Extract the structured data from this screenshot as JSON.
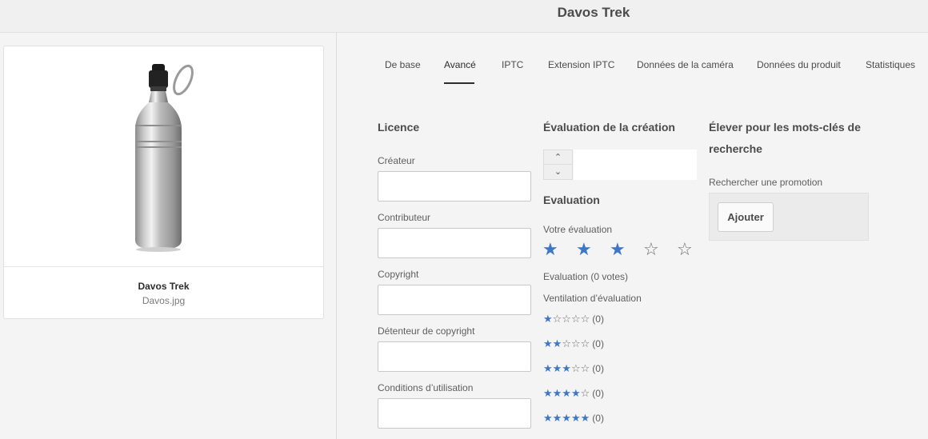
{
  "header": {
    "title": "Davos Trek"
  },
  "asset_card": {
    "name": "Davos Trek",
    "filename": "Davos.jpg"
  },
  "tabs": [
    {
      "label": "De base"
    },
    {
      "label": "Avancé",
      "active": true
    },
    {
      "label": "IPTC"
    },
    {
      "label": "Extension IPTC"
    },
    {
      "label": "Données de la caméra"
    },
    {
      "label": "Données du produit"
    },
    {
      "label": "Statistiques"
    }
  ],
  "license": {
    "heading": "Licence",
    "fields": [
      {
        "label": "Créateur",
        "value": ""
      },
      {
        "label": "Contributeur",
        "value": ""
      },
      {
        "label": "Copyright",
        "value": ""
      },
      {
        "label": "Détenteur de copyright",
        "value": ""
      },
      {
        "label": "Conditions d’utilisation",
        "value": ""
      }
    ]
  },
  "creation_rating": {
    "heading": "Évaluation de la création",
    "value": ""
  },
  "rating": {
    "heading": "Evaluation",
    "your_rating_label": "Votre évaluation",
    "your_rating_value": 3,
    "max": 5,
    "summary": "Evaluation (0 votes)",
    "breakdown_label": "Ventilation d’évaluation",
    "breakdown": [
      {
        "stars": 1,
        "count": "(0)"
      },
      {
        "stars": 2,
        "count": "(0)"
      },
      {
        "stars": 3,
        "count": "(0)"
      },
      {
        "stars": 4,
        "count": "(0)"
      },
      {
        "stars": 5,
        "count": "(0)"
      }
    ]
  },
  "promotion": {
    "heading_line1": "Élever pour les mots-clés de",
    "heading_line2": "recherche",
    "search_label": "Rechercher une promotion",
    "add_label": "Ajouter"
  },
  "colors": {
    "star_on": "#3d77c8",
    "star_off": "#6e6e6e",
    "tab_active": "#2c2c2c"
  }
}
